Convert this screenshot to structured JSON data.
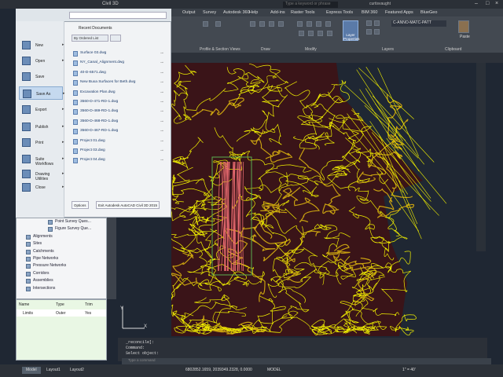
{
  "app": {
    "title": "Civil 3D",
    "search_placeholder": "Type a keyword or phrase",
    "user": "curtisvaught",
    "colors": {
      "contour_primary": "#f1f000",
      "contour_secondary": "#c8a010",
      "highlight": "#e86a70",
      "background": "#1f2733",
      "accent": "#5a7aa8"
    }
  },
  "ribbon": {
    "tabs": [
      "Output",
      "Survey",
      "Autodesk 360",
      "Help",
      "Add-ins",
      "Raster Tools",
      "Express Tools",
      "BIM 360",
      "Featured Apps",
      "BlueGeo"
    ],
    "panels": [
      "Profile & Section Views",
      "Draw",
      "Modify",
      "Layers",
      "Clipboard"
    ],
    "layer_properties_label": "Layer Properties",
    "layer_value": "C-ANNO-MATC-PATT",
    "paste_label": "Paste"
  },
  "app_menu": {
    "items": [
      {
        "label": "New",
        "icon": "new-document-icon",
        "has_submenu": true
      },
      {
        "label": "Open",
        "icon": "open-folder-icon",
        "has_submenu": true
      },
      {
        "label": "Save",
        "icon": "floppy-disk-icon",
        "has_submenu": false
      },
      {
        "label": "Save As",
        "icon": "save-as-icon",
        "has_submenu": true,
        "selected": true
      },
      {
        "label": "Export",
        "icon": "export-icon",
        "has_submenu": true
      },
      {
        "label": "Publish",
        "icon": "publish-icon",
        "has_submenu": true
      },
      {
        "label": "Print",
        "icon": "printer-icon",
        "has_submenu": true
      },
      {
        "label": "Suite Workflows",
        "icon": "workflow-icon",
        "has_submenu": true
      },
      {
        "label": "Drawing Utilities",
        "icon": "utilities-icon",
        "has_submenu": true
      },
      {
        "label": "Close",
        "icon": "close-document-icon",
        "has_submenu": true
      }
    ],
    "recent_title": "Recent Documents",
    "ordered_by": "By Ordered List",
    "recent_files": [
      "Surface 03.dwg",
      "NY_Canal_Alignment.dwg",
      "40-D-6571.dwg",
      "New Buxa Surfaces for Beth.dwg",
      "Excavation Plan.dwg",
      "3560-D-471-RD-1.dwg",
      "3560-D-469-RD-1.dwg",
      "3560-D-468-RD-1.dwg",
      "3560-D-467-RD-1.dwg",
      "Project 01.dwg",
      "Project 03.dwg",
      "Project 04.dwg"
    ],
    "options_label": "Options",
    "exit_label": "Exit Autodesk AutoCAD Civil 3D 2015"
  },
  "toolspace": {
    "items": [
      {
        "label": "Point Survey Ques...",
        "indent": 3
      },
      {
        "label": "Figure Survey Que...",
        "indent": 3
      },
      {
        "label": "Alignments",
        "indent": 2
      },
      {
        "label": "Sites",
        "indent": 2
      },
      {
        "label": "Catchments",
        "indent": 2
      },
      {
        "label": "Pipe Networks",
        "indent": 2
      },
      {
        "label": "Pressure Networks",
        "indent": 2
      },
      {
        "label": "Corridors",
        "indent": 2
      },
      {
        "label": "Assemblies",
        "indent": 2
      },
      {
        "label": "Intersections",
        "indent": 2
      }
    ]
  },
  "properties": {
    "headers": [
      "Name",
      "Type",
      "Trim"
    ],
    "rows": [
      {
        "name": "Limits",
        "type": "Outer",
        "trim": "Yes"
      }
    ]
  },
  "command": {
    "history": [
      "_reconcile]:",
      "Command:",
      "Select object:"
    ],
    "placeholder": "Type a command"
  },
  "status": {
    "layouts": [
      "Model",
      "Layout1",
      "Layout2"
    ],
    "coordinates": "6802852.1659, 2039349.2328, 0.0000",
    "space": "MODEL",
    "scale": "1\" = 40'"
  }
}
